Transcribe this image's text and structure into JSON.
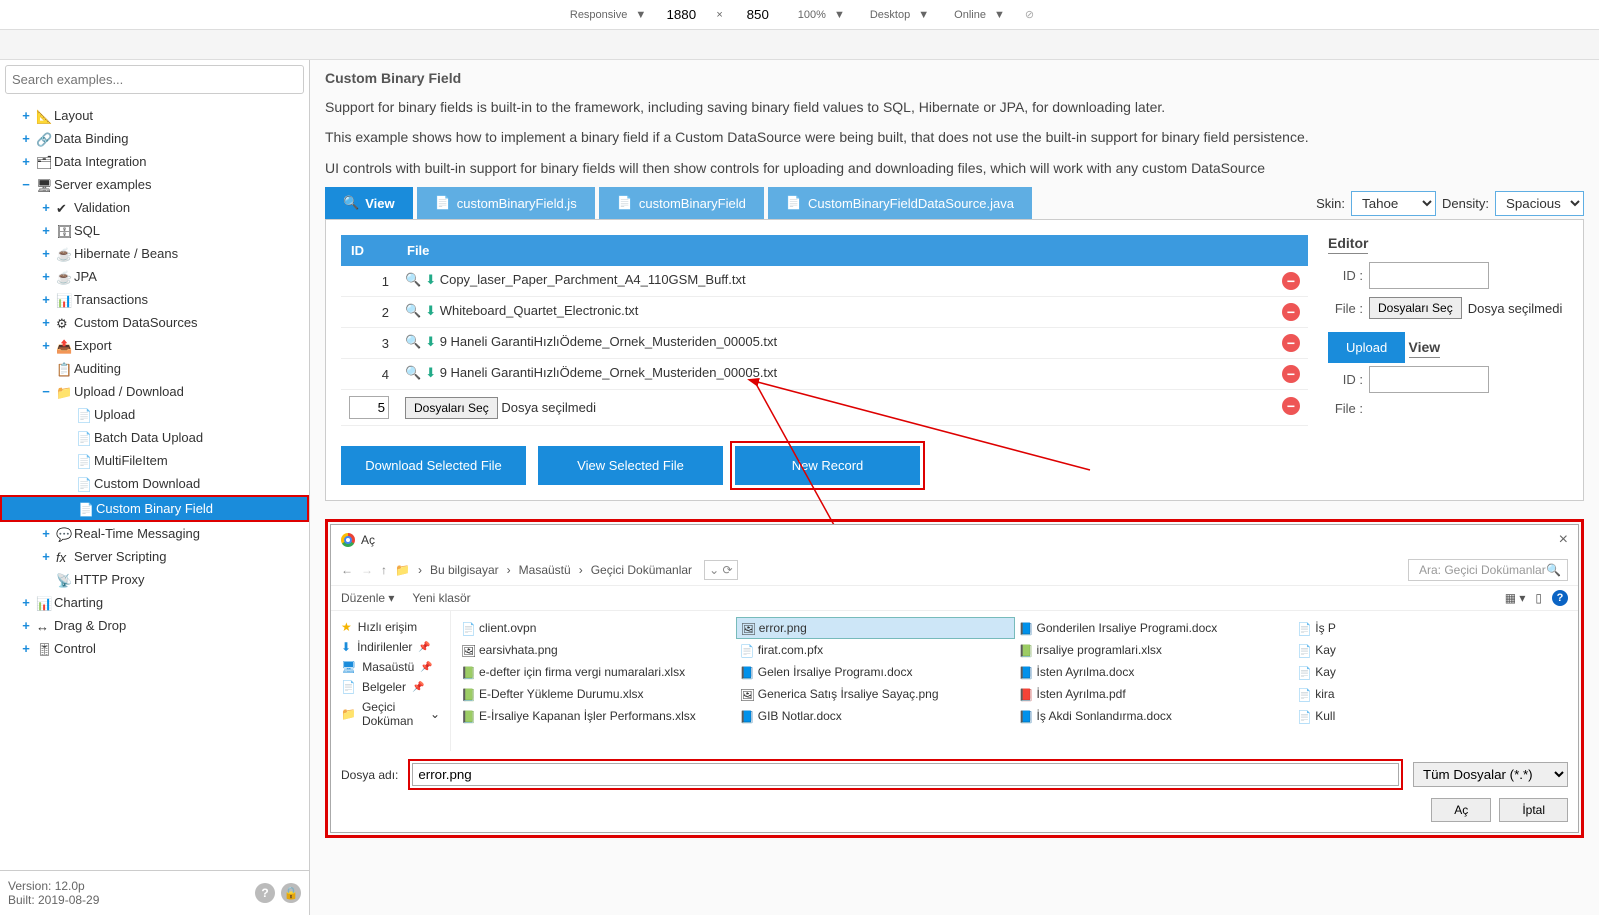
{
  "devtools": {
    "mode": "Responsive",
    "width": "1880",
    "height": "850",
    "zoom": "100%",
    "device": "Desktop",
    "network": "Online"
  },
  "search_placeholder": "Search examples...",
  "tree": {
    "layout": "Layout",
    "dataBinding": "Data Binding",
    "dataIntegration": "Data Integration",
    "serverExamples": "Server examples",
    "validation": "Validation",
    "sql": "SQL",
    "hibernate": "Hibernate / Beans",
    "jpa": "JPA",
    "transactions": "Transactions",
    "customDS": "Custom DataSources",
    "export": "Export",
    "auditing": "Auditing",
    "uploadDownload": "Upload / Download",
    "upload": "Upload",
    "batchUpload": "Batch Data Upload",
    "multiFile": "MultiFileItem",
    "customDownload": "Custom Download",
    "customBinary": "Custom Binary Field",
    "rtm": "Real-Time Messaging",
    "scripting": "Server Scripting",
    "httpProxy": "HTTP Proxy",
    "charting": "Charting",
    "dragDrop": "Drag & Drop",
    "control": "Control"
  },
  "version": {
    "line1": "Version: 12.0p",
    "line2": "Built: 2019-08-29"
  },
  "page": {
    "title": "Custom Binary Field",
    "desc1": "Support for binary fields is built-in to the framework, including saving binary field values to SQL, Hibernate or JPA, for downloading later.",
    "desc2": "This example shows how to implement a binary field if a Custom DataSource were being built, that does not use the built-in support for binary field persistence.",
    "desc3": "UI controls with built-in support for binary fields will then show controls for uploading and downloading files, which will work with any custom DataSource"
  },
  "tabs": {
    "view": "View",
    "js": "customBinaryField.js",
    "ds": "customBinaryField",
    "java": "CustomBinaryFieldDataSource.java"
  },
  "skin": {
    "label": "Skin:",
    "value": "Tahoe"
  },
  "density": {
    "label": "Density:",
    "value": "Spacious"
  },
  "table": {
    "headers": {
      "id": "ID",
      "file": "File"
    },
    "rows": [
      {
        "id": "1",
        "file": "Copy_laser_Paper_Parchment_A4_110GSM_Buff.txt"
      },
      {
        "id": "2",
        "file": "Whiteboard_Quartet_Electronic.txt"
      },
      {
        "id": "3",
        "file": "9 Haneli GarantiHızlıÖdeme_Ornek_Musteriden_00005.txt"
      },
      {
        "id": "4",
        "file": "9 Haneli GarantiHızlıÖdeme_Ornek_Musteriden_00005.txt"
      }
    ],
    "newRow": {
      "id": "5",
      "selectBtn": "Dosyaları Seç",
      "noFile": "Dosya seçilmedi"
    }
  },
  "editor": {
    "title": "Editor",
    "idLabel": "ID :",
    "fileLabel": "File :",
    "selectBtn": "Dosyaları Seç",
    "noFile": "Dosya seçilmedi",
    "uploadBtn": "Upload",
    "viewTitle": "View"
  },
  "actions": {
    "download": "Download Selected File",
    "view": "View Selected File",
    "newRec": "New Record"
  },
  "dialog": {
    "title": "Aç",
    "crumbs": [
      "Bu bilgisayar",
      "Masaüstü",
      "Geçici Dokümanlar"
    ],
    "searchPlaceholder": "Ara: Geçici Dokümanlar",
    "arrange": "Düzenle",
    "newFolder": "Yeni klasör",
    "quickAccess": "Hızlı erişim",
    "downloads": "İndirilenler",
    "desktop": "Masaüstü",
    "documents": "Belgeler",
    "tempDocs": "Geçici Doküman",
    "files": {
      "c1": [
        "client.ovpn",
        "earsivhata.png",
        "e-defter için firma vergi numaralari.xlsx",
        "E-Defter Yükleme Durumu.xlsx",
        "E-İrsaliye Kapanan İşler Performans.xlsx"
      ],
      "c2": [
        "error.png",
        "firat.com.pfx",
        "Gelen İrsaliye Programı.docx",
        "Generica Satış İrsaliye Sayaç.png",
        "GIB Notlar.docx"
      ],
      "c3": [
        "Gonderilen Irsaliye Programi.docx",
        "irsaliye programlari.xlsx",
        "İsten Ayrılma.docx",
        "İsten Ayrılma.pdf",
        "İş Akdi Sonlandırma.docx"
      ],
      "c4": [
        "İş P",
        "Kay",
        "Kay",
        "kira",
        "Kull"
      ]
    },
    "filenameLabel": "Dosya adı:",
    "filenameValue": "error.png",
    "filterValue": "Tüm Dosyalar (*.*)",
    "openBtn": "Aç",
    "cancelBtn": "İptal"
  }
}
